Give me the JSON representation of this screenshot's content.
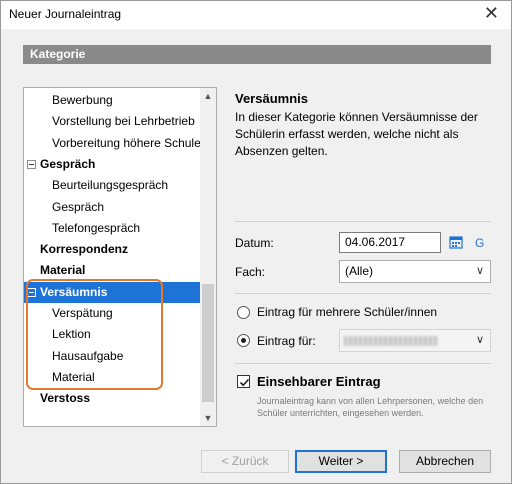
{
  "window": {
    "title": "Neuer Journaleintrag",
    "close_glyph": "✕"
  },
  "category_header": "Kategorie",
  "tree": {
    "items": [
      {
        "label": "Bewerbung",
        "level": "child"
      },
      {
        "label": "Vorstellung bei Lehrbetrieb",
        "level": "child"
      },
      {
        "label": "Vorbereitung höhere Schule",
        "level": "child"
      },
      {
        "label": "Gespräch",
        "level": "parent",
        "expanded": true
      },
      {
        "label": "Beurteilungsgespräch",
        "level": "child"
      },
      {
        "label": "Gespräch",
        "level": "child"
      },
      {
        "label": "Telefongespräch",
        "level": "child"
      },
      {
        "label": "Korrespondenz",
        "level": "parent"
      },
      {
        "label": "Material",
        "level": "parent"
      },
      {
        "label": "Versäumnis",
        "level": "parent",
        "expanded": true,
        "selected": true
      },
      {
        "label": "Verspätung",
        "level": "child"
      },
      {
        "label": "Lektion",
        "level": "child"
      },
      {
        "label": "Hausaufgabe",
        "level": "child"
      },
      {
        "label": "Material",
        "level": "child"
      },
      {
        "label": "Verstoss",
        "level": "parent"
      }
    ],
    "scroll_up_glyph": "▲",
    "scroll_down_glyph": "▼"
  },
  "detail": {
    "title": "Versäumnis",
    "description": "In dieser Kategorie können Versäumnisse der Schülerin erfasst werden, welche nicht als Absenzen gelten."
  },
  "form": {
    "date_label": "Datum:",
    "date_value": "04.06.2017",
    "g_link": "G",
    "subject_label": "Fach:",
    "subject_value": "(Alle)",
    "radio_multiple_label": "Eintrag für mehrere Schüler/innen",
    "radio_single_label": "Eintrag für:",
    "radio_selected": "single",
    "visible_checkbox_label": "Einsehbarer Eintrag",
    "visible_checked": true,
    "visible_note": "Journaleintrag kann von allen Lehrpersonen, welche den Schüler unterrichten, eingesehen werden."
  },
  "buttons": {
    "back": "< Zurück",
    "next": "Weiter >",
    "cancel": "Abbrechen"
  },
  "colors": {
    "selection": "#1e73d6",
    "highlight_annotation": "#e8772e",
    "category_bar": "#8a8a8a"
  }
}
